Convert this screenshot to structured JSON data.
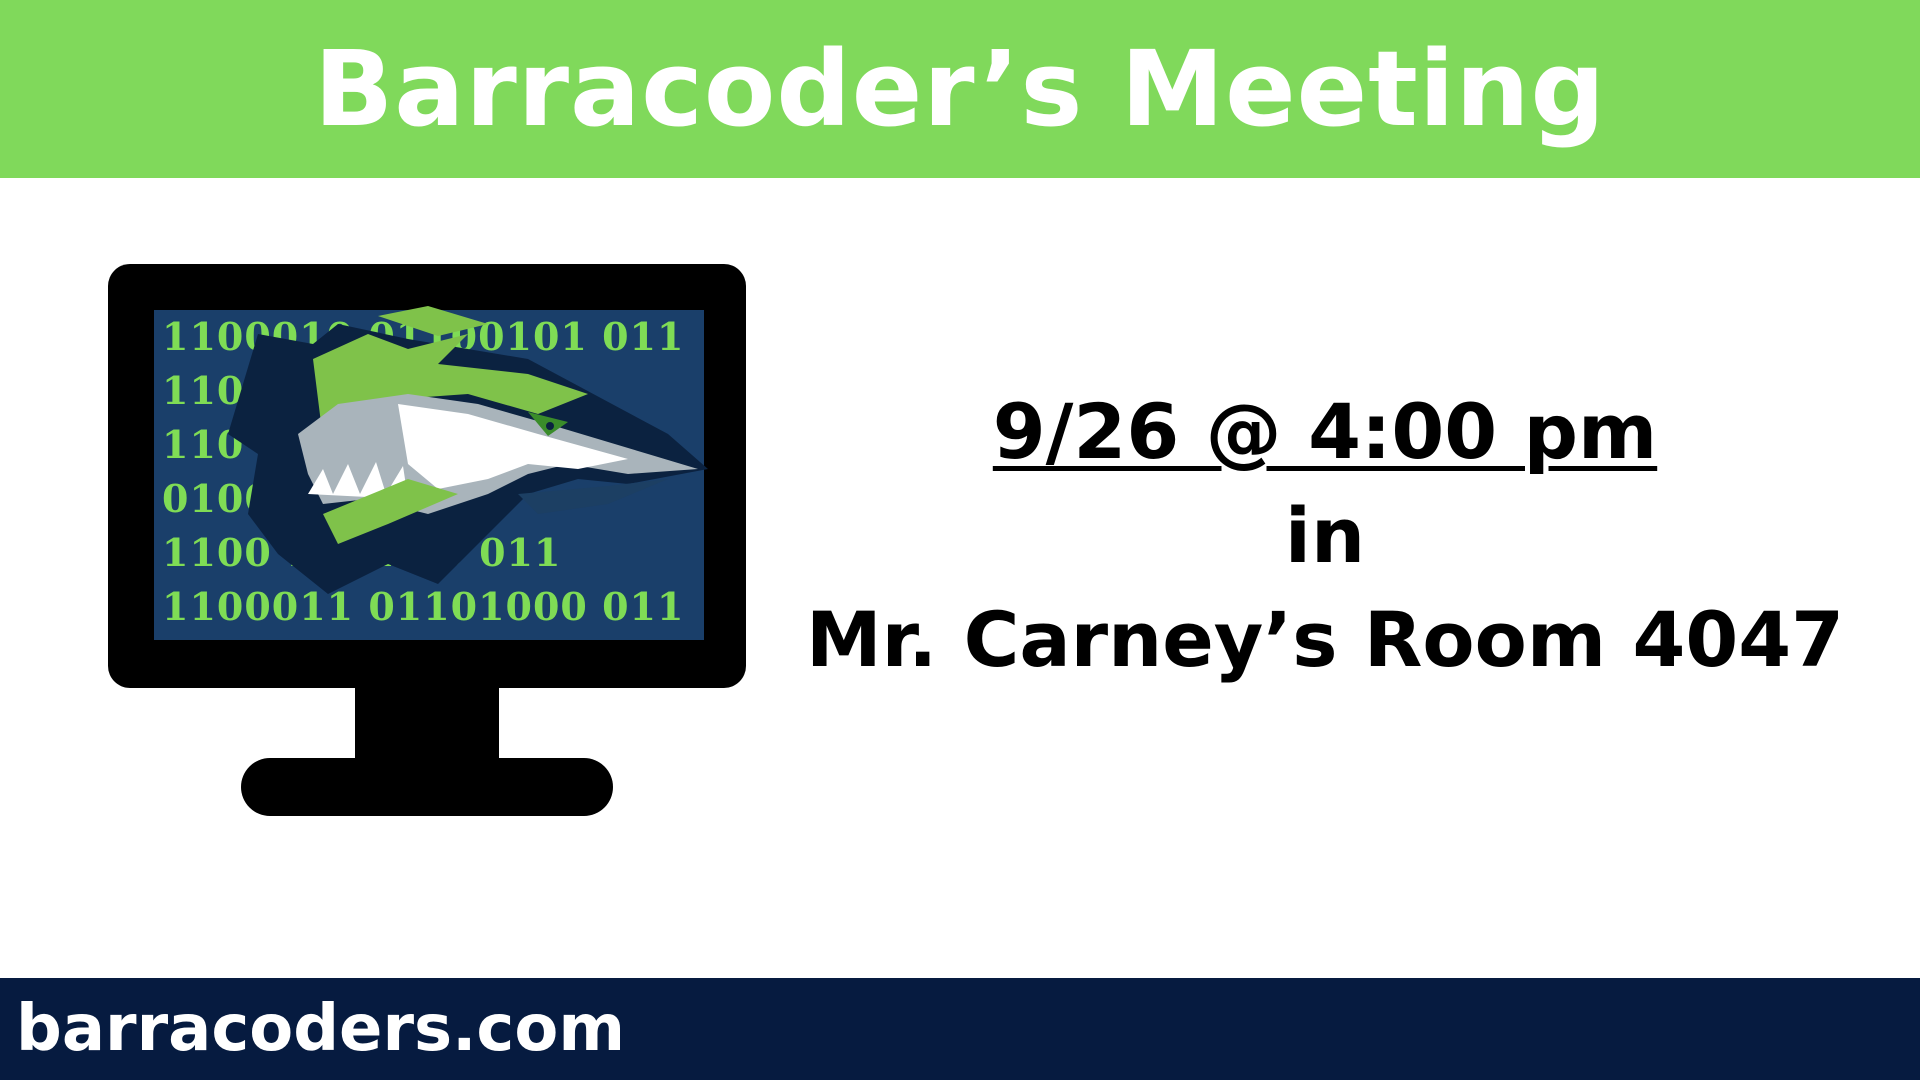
{
  "header": {
    "title": "Barracoder’s  Meeting",
    "background_color": "#80d95b"
  },
  "logo": {
    "icon_name": "barracuda-monitor-logo-icon",
    "binary_lines": [
      "1100010 01100101 011",
      "1100 00101 011",
      "110 011",
      "0100 0 011",
      "1100 1101 00 011",
      "1100011 01101000 011"
    ],
    "binary_color": "#7fdc55",
    "screen_color": "#1a3f6a"
  },
  "event": {
    "date_time": "9/26 @ 4:00 pm",
    "connector": "in",
    "location": "Mr. Carney’s Room 4047"
  },
  "footer": {
    "website": "barracoders.com",
    "background_color": "#061b40"
  }
}
